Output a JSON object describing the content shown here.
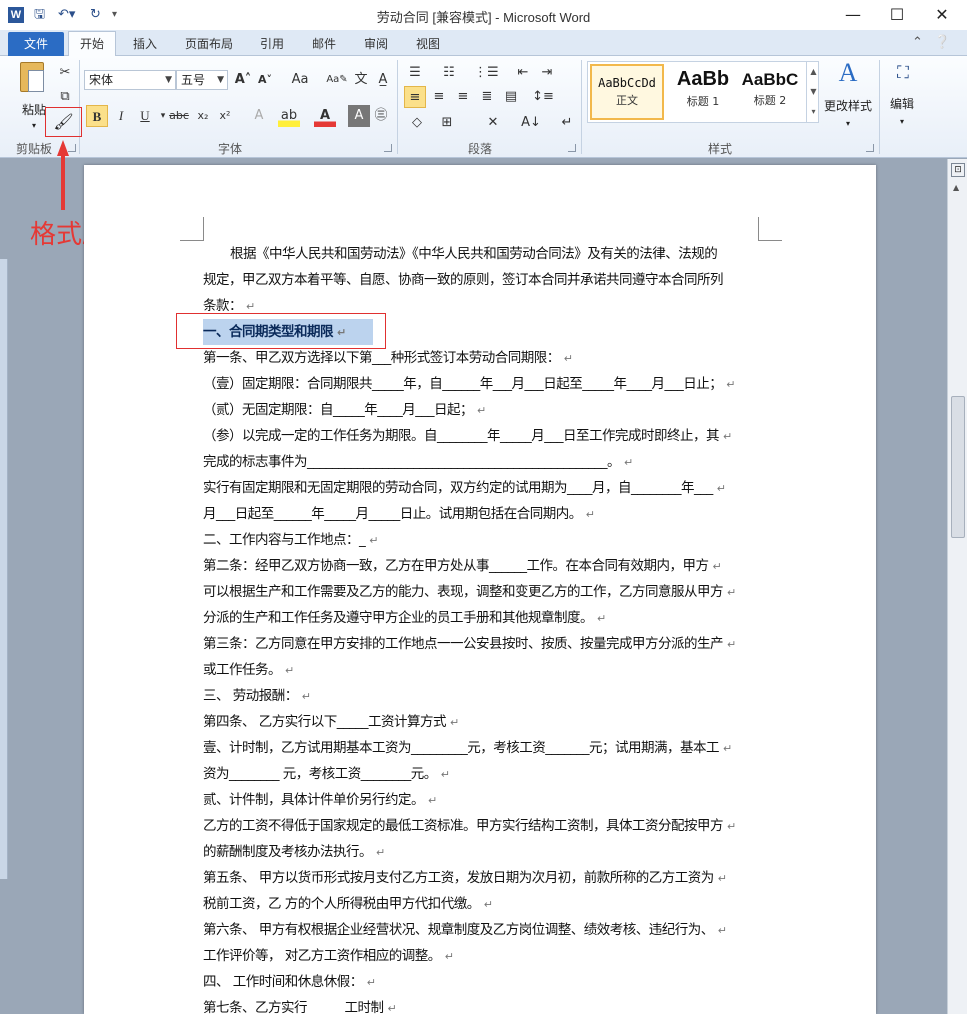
{
  "titlebar": {
    "app_icon": "W",
    "title": "劳动合同 [兼容模式] - Microsoft Word",
    "minimize": "—",
    "maximize": "☐",
    "close": "✕"
  },
  "tabs": [
    "文件",
    "开始",
    "插入",
    "页面布局",
    "引用",
    "邮件",
    "审阅",
    "视图"
  ],
  "ribbon": {
    "clipboard": {
      "paste_label": "粘贴",
      "group_label": "剪贴板"
    },
    "font": {
      "font_name": "宋体",
      "font_size": "五号",
      "group_label": "字体",
      "bold": "B",
      "italic": "I",
      "underline": "U",
      "strike": "abc",
      "subscript": "x₂",
      "superscript": "x²",
      "change_case": "Aa"
    },
    "paragraph": {
      "group_label": "段落"
    },
    "styles": {
      "group_label": "样式",
      "items": [
        {
          "sample": "AaBbCcDd",
          "name": "正文"
        },
        {
          "sample": "AaBb",
          "name": "标题 1"
        },
        {
          "sample": "AaBbC",
          "name": "标题 2"
        }
      ],
      "change_styles": "更改样式"
    },
    "editing": {
      "label": "编辑"
    }
  },
  "annotation": {
    "label": "格式刷"
  },
  "document": {
    "paragraphs": [
      "根据《中华人民共和国劳动法》《中华人民共和国劳动合同法》及有关的法律、法规的",
      "规定，甲乙双方本着平等、自愿、协商一致的原则，签订本合同并承诺共同遵守本合同所列",
      "条款：",
      "一、合同期类型和期限",
      "第一条、甲乙双方选择以下第___种形式签订本劳动合同期限：",
      "（壹）固定期限：合同期限共_____年，自______年___月___日起至_____年____月___日止；",
      "（贰）无固定期限：自_____年____月___日起；",
      "（参）以完成一定的工作任务为期限。自________年_____月___日至工作完成时即终止，其",
      "完成的标志事件为________________________________________________。",
      "实行有固定期限和无固定期限的劳动合同，双方约定的试用期为____月，自________年___",
      "月___日起至______年_____月_____日止。试用期包括在合同期内。",
      "二、工作内容与工作地点：_",
      "第二条：经甲乙双方协商一致，乙方在甲方处从事______工作。在本合同有效期内，甲方",
      "可以根据生产和工作需要及乙方的能力、表现，调整和变更乙方的工作，乙方同意服从甲方",
      "分派的生产和工作任务及遵守甲方企业的员工手册和其他规章制度。",
      "第三条：乙方同意在甲方安排的工作地点一一公安县按时、按质、按量完成甲方分派的生产",
      "或工作任务。",
      "三、 劳动报酬：",
      "第四条、 乙方实行以下_____工资计算方式",
      "壹、计时制，乙方试用期基本工资为_________元，考核工资_______元；试用期满，基本工",
      "资为________ 元，考核工资________元。",
      "贰、计件制，具体计件单价另行约定。",
      "乙方的工资不得低于国家规定的最低工资标准。甲方实行结构工资制，具体工资分配按甲方",
      "的薪酬制度及考核办法执行。",
      "第五条、 甲方以货币形式按月支付乙方工资，发放日期为次月初，前款所称的乙方工资为",
      "税前工资，乙 方的个人所得税由甲方代扣代缴。",
      "第六条、 甲方有权根据企业经营状况、规章制度及乙方岗位调整、绩效考核、违纪行为、",
      "工作评价等， 对乙方工资作相应的调整。",
      "四、 工作时间和休息休假：",
      "第七条、乙方实行______工时制"
    ],
    "paragraph_mark": "↵"
  }
}
